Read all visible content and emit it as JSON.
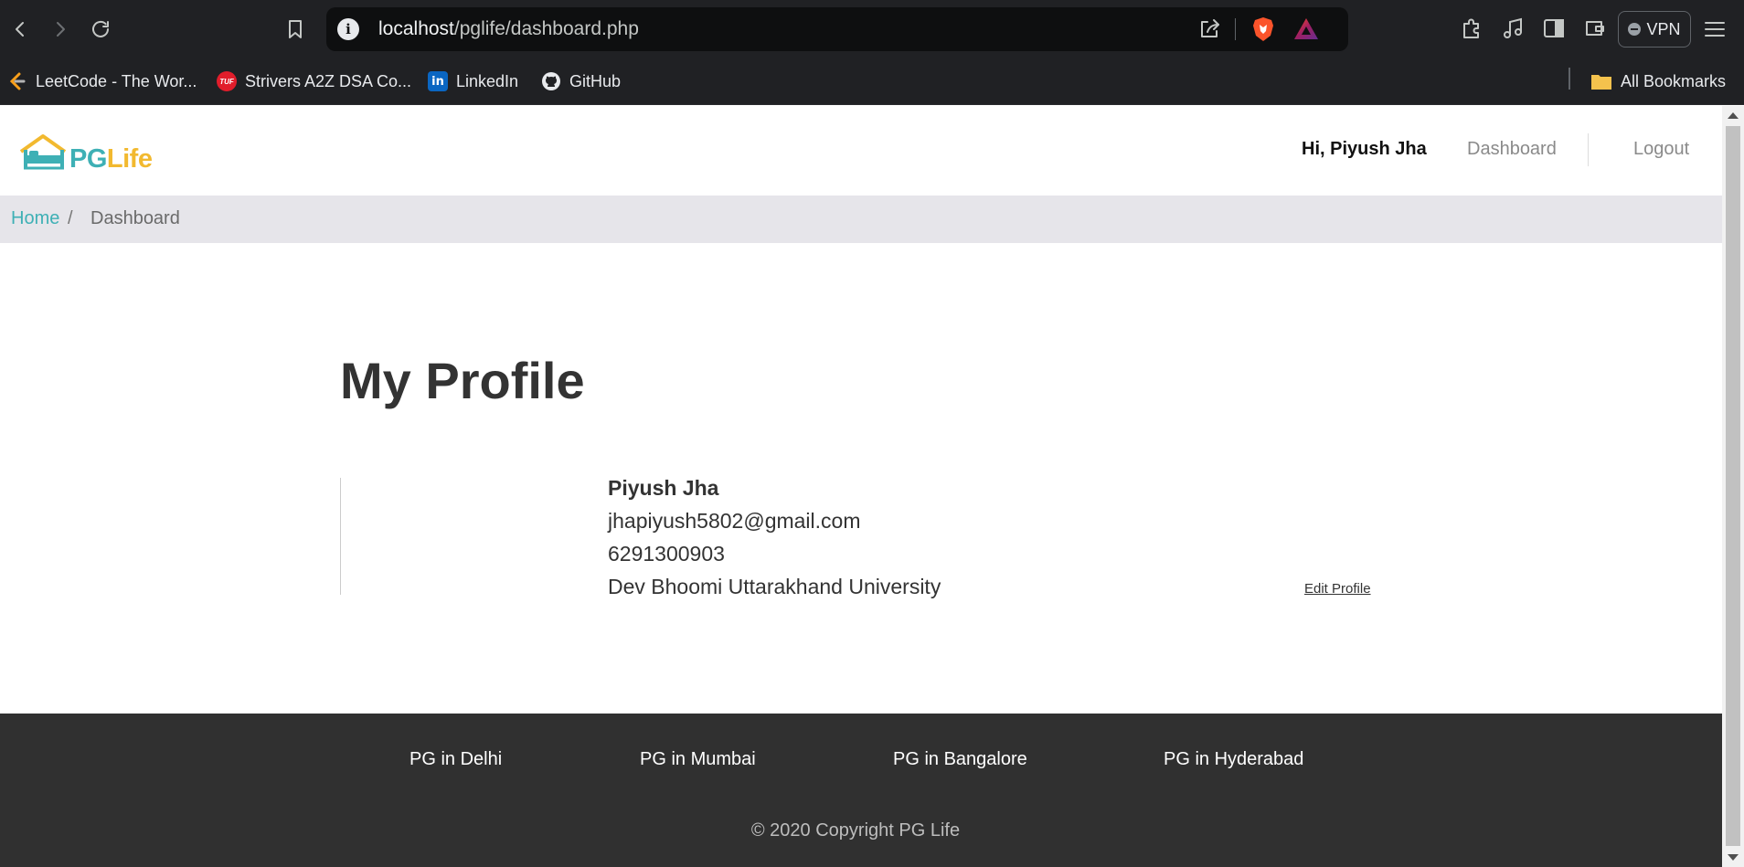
{
  "browser": {
    "url_host": "localhost",
    "url_path": "/pglife/dashboard.php",
    "vpn_label": "VPN",
    "bookmarks": [
      {
        "label": "LeetCode - The Wor...",
        "icon": "leetcode-icon"
      },
      {
        "label": "Strivers A2Z DSA Co...",
        "icon": "tuf-icon",
        "icon_text": "TUF"
      },
      {
        "label": "LinkedIn",
        "icon": "linkedin-icon",
        "icon_text": "in"
      },
      {
        "label": "GitHub",
        "icon": "github-icon"
      }
    ],
    "all_bookmarks_label": "All Bookmarks"
  },
  "header": {
    "logo_pg": "PG",
    "logo_life": "Life",
    "greeting": "Hi, Piyush Jha",
    "dashboard_link": "Dashboard",
    "logout_link": "Logout"
  },
  "breadcrumb": {
    "home": "Home",
    "separator": "/",
    "current": "Dashboard"
  },
  "profile": {
    "title": "My Profile",
    "name": "Piyush Jha",
    "email": "jhapiyush5802@gmail.com",
    "phone": "6291300903",
    "college": "Dev Bhoomi Uttarakhand University",
    "edit_label": "Edit Profile"
  },
  "footer": {
    "links": [
      "PG in Delhi",
      "PG in Mumbai",
      "PG in Bangalore",
      "PG in Hyderabad"
    ],
    "copyright": "© 2020 Copyright PG Life"
  },
  "colors": {
    "brand_teal": "#3eb0b5",
    "brand_yellow": "#f2b92f",
    "breadcrumb_bg": "#e6e5ea",
    "footer_bg": "#303030"
  }
}
